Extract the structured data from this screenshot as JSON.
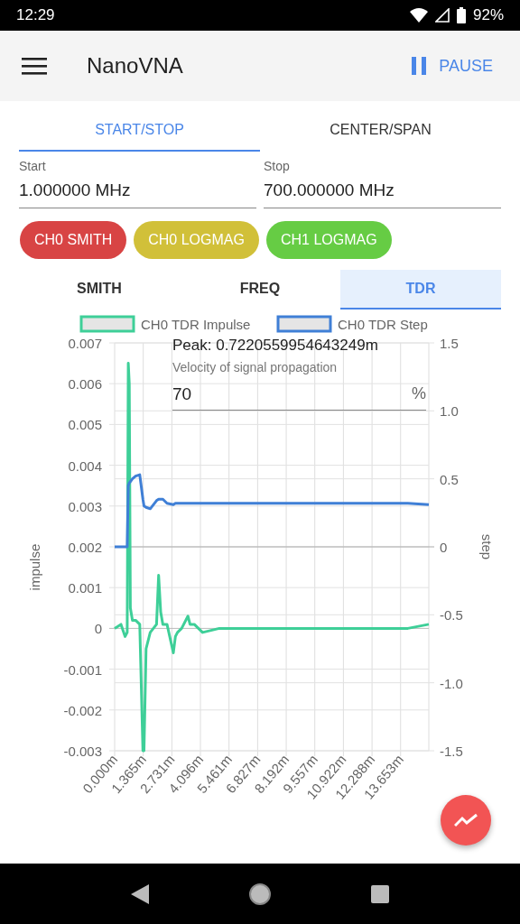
{
  "status_bar": {
    "time": "12:29",
    "battery": "92%"
  },
  "app_bar": {
    "title": "NanoVNA",
    "action": "PAUSE"
  },
  "range_tabs": [
    {
      "label": "START/STOP",
      "selected": true
    },
    {
      "label": "CENTER/SPAN",
      "selected": false
    }
  ],
  "fields": [
    {
      "label": "Start",
      "value": "1.000000 MHz"
    },
    {
      "label": "Stop",
      "value": "700.000000 MHz"
    }
  ],
  "channels": [
    {
      "label": "CH0 SMITH",
      "color": "#d84444"
    },
    {
      "label": "CH0 LOGMAG",
      "color": "#d1c039"
    },
    {
      "label": "CH1 LOGMAG",
      "color": "#66cc44"
    }
  ],
  "view_tabs": [
    {
      "label": "SMITH",
      "selected": false
    },
    {
      "label": "FREQ",
      "selected": false
    },
    {
      "label": "TDR",
      "selected": true
    }
  ],
  "tdr": {
    "peak": "Peak: 0.7220559954643249m",
    "velocity_label": "Velocity of signal propagation",
    "velocity_value": "70",
    "velocity_unit": "%",
    "chart_data": {
      "type": "line",
      "grid": true,
      "legend": "top",
      "ylabel": "impulse",
      "y2label": "step",
      "xlim": [
        0,
        15
      ],
      "ylim": [
        -0.003,
        0.007
      ],
      "y2lim": [
        -1.5,
        1.5
      ],
      "x": [
        0,
        0.3,
        0.5,
        0.6,
        0.65,
        0.7,
        0.75,
        0.85,
        1.0,
        1.2,
        1.35,
        1.4,
        1.5,
        1.7,
        2.0,
        2.1,
        2.2,
        2.3,
        2.5,
        2.8,
        2.9,
        3.0,
        3.2,
        3.5,
        3.6,
        3.8,
        4.2,
        5.0,
        6.0,
        8,
        10,
        12,
        14,
        15
      ],
      "series": [
        {
          "name": "CH0 TDR Impulse",
          "color": "#3ecf98",
          "values": [
            0,
            0.0001,
            -0.0002,
            -0.0001,
            0.0065,
            0.006,
            0.0005,
            0.0002,
            0.0002,
            0.0001,
            -0.003,
            -0.003,
            -0.0005,
            -0.0001,
            0.0001,
            0.0013,
            0.0004,
            0.0001,
            0.0001,
            -0.0006,
            -0.0002,
            -0.0001,
            0,
            0.0003,
            0.0001,
            0.0001,
            -0.0001,
            0,
            0,
            0,
            0,
            0,
            0,
            0.0001
          ]
        },
        {
          "name": "CH0 TDR Step",
          "color": "#3f7fd6",
          "axis": "y2",
          "values": [
            0,
            0,
            0,
            0,
            0.45,
            0.47,
            0.48,
            0.5,
            0.52,
            0.53,
            0.35,
            0.3,
            0.29,
            0.28,
            0.34,
            0.35,
            0.35,
            0.35,
            0.32,
            0.31,
            0.32,
            0.32,
            0.32,
            0.32,
            0.32,
            0.32,
            0.32,
            0.32,
            0.32,
            0.32,
            0.32,
            0.32,
            0.32,
            0.31
          ]
        }
      ],
      "xticks": [
        {
          "value": 0,
          "label": "0.000m"
        },
        {
          "value": 1.365,
          "label": "1.365m"
        },
        {
          "value": 2.731,
          "label": "2.731m"
        },
        {
          "value": 4.096,
          "label": "4.096m"
        },
        {
          "value": 5.461,
          "label": "5.461m"
        },
        {
          "value": 6.827,
          "label": "6.827m"
        },
        {
          "value": 8.192,
          "label": "8.192m"
        },
        {
          "value": 9.557,
          "label": "9.557m"
        },
        {
          "value": 10.922,
          "label": "10.922m"
        },
        {
          "value": 12.288,
          "label": "12.288m"
        },
        {
          "value": 13.653,
          "label": "13.653m"
        }
      ],
      "yticks": [
        {
          "value": 0.007,
          "label": "0.007"
        },
        {
          "value": 0.006,
          "label": "0.006"
        },
        {
          "value": 0.005,
          "label": "0.005"
        },
        {
          "value": 0.004,
          "label": "0.004"
        },
        {
          "value": 0.003,
          "label": "0.003"
        },
        {
          "value": 0.002,
          "label": "0.002"
        },
        {
          "value": 0.001,
          "label": "0.001"
        },
        {
          "value": 0,
          "label": "0"
        },
        {
          "value": -0.001,
          "label": "-0.001"
        },
        {
          "value": -0.002,
          "label": "-0.002"
        },
        {
          "value": -0.003,
          "label": "-0.003"
        }
      ],
      "y2ticks": [
        {
          "value": 1.5,
          "label": "1.5"
        },
        {
          "value": 1.0,
          "label": "1.0"
        },
        {
          "value": 0.5,
          "label": "0.5"
        },
        {
          "value": 0,
          "label": "0"
        },
        {
          "value": -0.5,
          "label": "-0.5"
        },
        {
          "value": -1.0,
          "label": "-1.0"
        },
        {
          "value": -1.5,
          "label": "-1.5"
        }
      ]
    }
  }
}
